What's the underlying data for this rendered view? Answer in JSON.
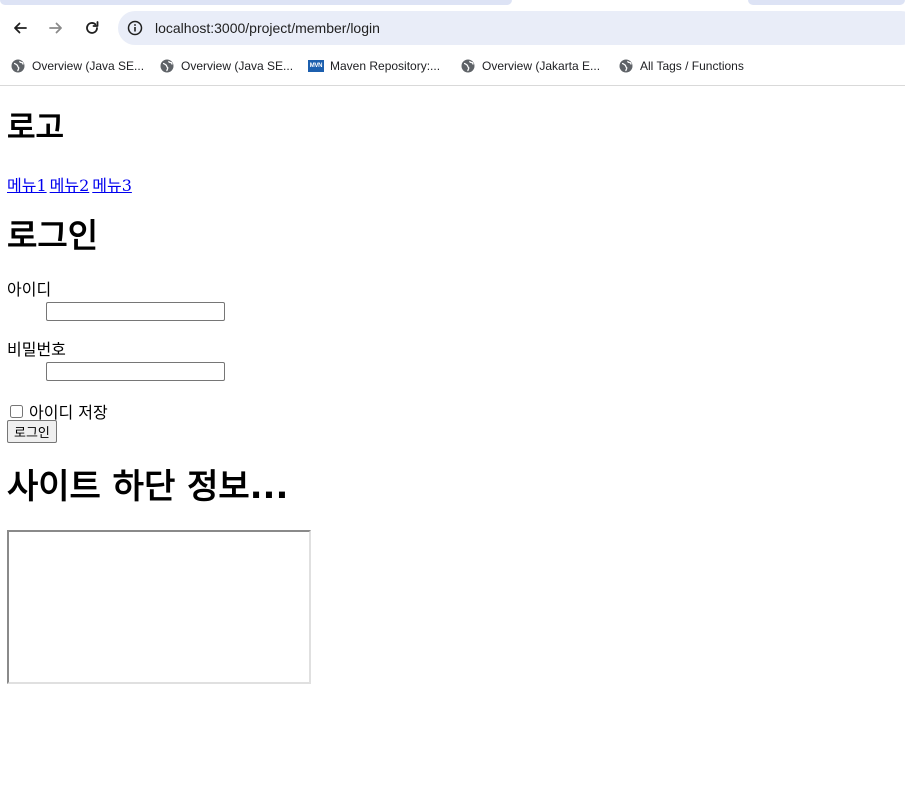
{
  "browser": {
    "url": "localhost:3000/project/member/login",
    "bookmarks": [
      {
        "label": "Overview (Java SE...",
        "icon": "globe-icon"
      },
      {
        "label": "Overview (Java SE...",
        "icon": "globe-icon"
      },
      {
        "label": "Maven Repository:...",
        "icon": "maven-icon",
        "icon_text": "MVN"
      },
      {
        "label": "Overview (Jakarta E...",
        "icon": "globe-icon"
      },
      {
        "label": "All Tags / Functions",
        "icon": "globe-icon"
      }
    ]
  },
  "page": {
    "logo": "로고",
    "menu": [
      "메뉴1",
      "메뉴2",
      "메뉴3"
    ],
    "login_title": "로그인",
    "id_label": "아이디",
    "id_value": "",
    "password_label": "비밀번호",
    "password_value": "",
    "save_id_label": "아이디 저장",
    "save_id_checked": false,
    "login_button": "로그인",
    "footer_title": "사이트 하단 정보..."
  },
  "colors": {
    "link": "#0000ee",
    "omnibox_bg": "#e9edf8",
    "maven_brand": "#1c5fae"
  }
}
